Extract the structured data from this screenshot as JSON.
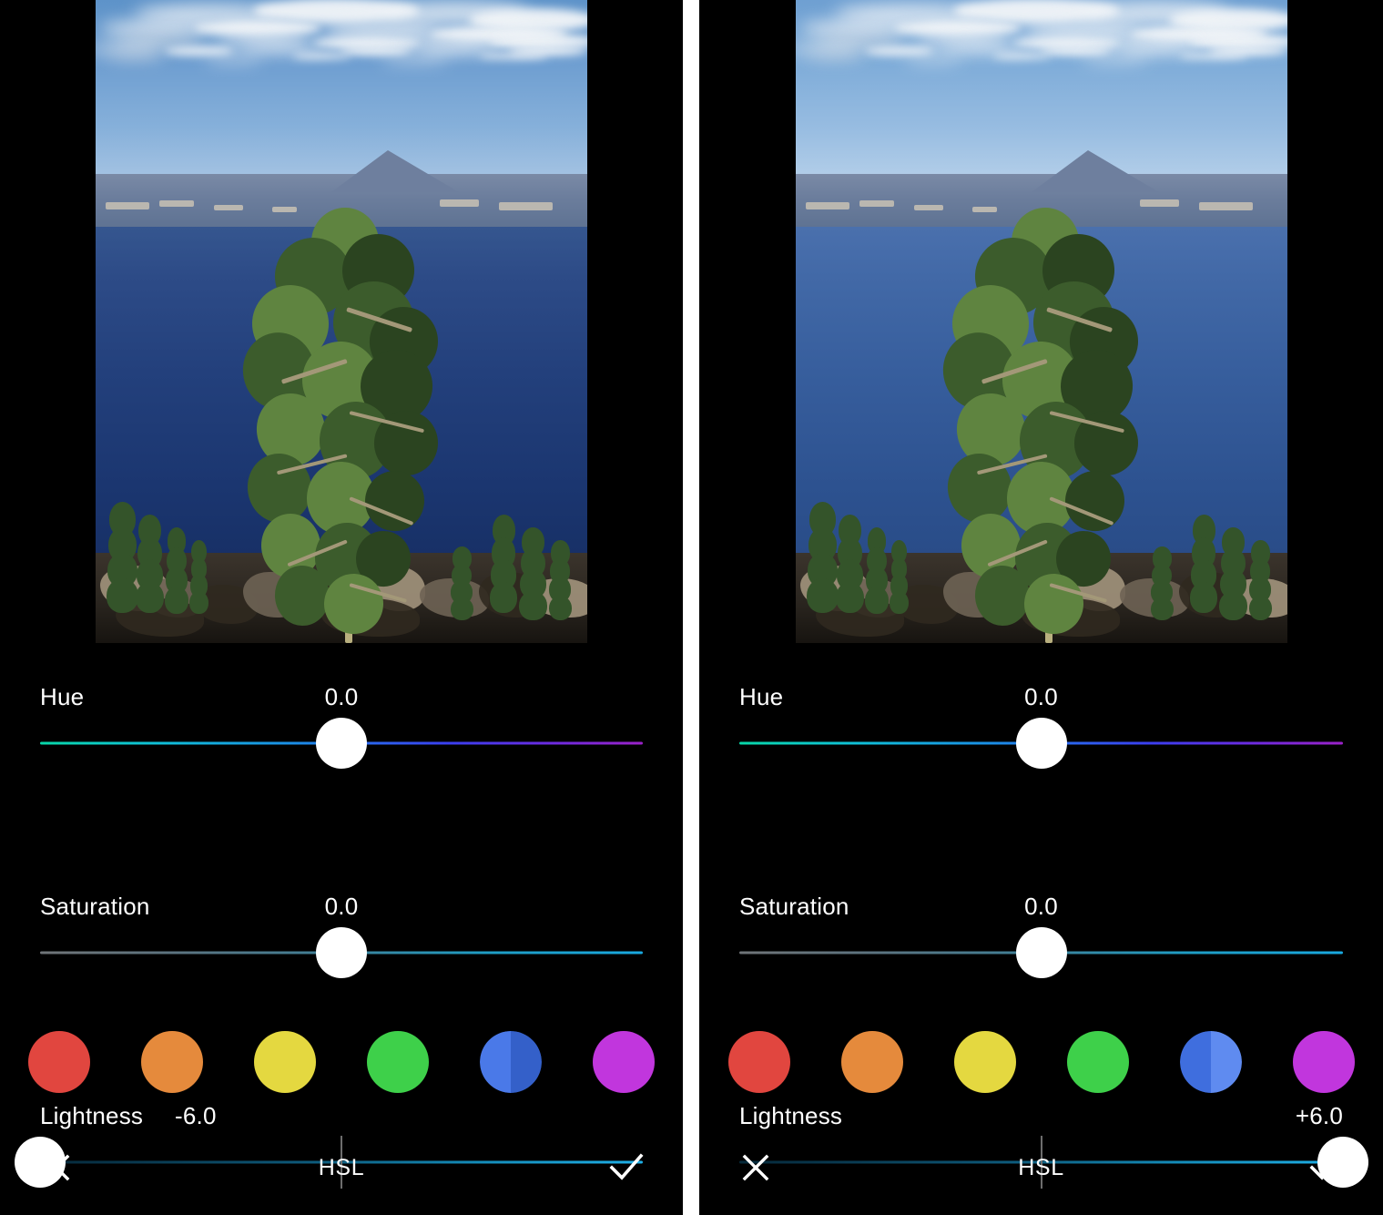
{
  "app": {
    "editor_title": "HSL",
    "background": "#000000",
    "text_color": "#ffffff"
  },
  "panels": [
    {
      "id": "before",
      "photo": {
        "alt_name": "crater-lake-photo",
        "scene": "Crater Lake with Wizard Island, pine tree in foreground",
        "variant": "normal"
      },
      "sliders": [
        {
          "name": "Hue",
          "value": "0.0",
          "knob_percent": 50,
          "value_align": "center",
          "gradient": "hue",
          "show_center_tick": false
        },
        {
          "name": "Saturation",
          "value": "0.0",
          "knob_percent": 50,
          "value_align": "center",
          "gradient": "sat",
          "show_center_tick": false
        },
        {
          "name": "Lightness",
          "value": "-6.0",
          "knob_percent": 0,
          "value_align": "inline",
          "gradient": "light",
          "show_center_tick": true
        }
      ],
      "swatches": [
        {
          "name": "red",
          "color": "#e1463f",
          "selected": false
        },
        {
          "name": "orange",
          "color": "#e58a3c",
          "selected": false
        },
        {
          "name": "yellow",
          "color": "#e4d840",
          "selected": false
        },
        {
          "name": "green",
          "color": "#3ed04a",
          "selected": false
        },
        {
          "name": "blue",
          "color": "#3f6ede",
          "color_left": "#4a79e8",
          "color_right": "#3460c9",
          "selected": true
        },
        {
          "name": "purple",
          "color": "#c136dd",
          "selected": false
        }
      ],
      "bottom_bar": {
        "cancel_icon": "close-icon",
        "title": "HSL",
        "confirm_icon": "check-icon"
      }
    },
    {
      "id": "after",
      "photo": {
        "alt_name": "crater-lake-photo",
        "scene": "Crater Lake with Wizard Island, pine tree in foreground",
        "variant": "brightened"
      },
      "sliders": [
        {
          "name": "Hue",
          "value": "0.0",
          "knob_percent": 50,
          "value_align": "center",
          "gradient": "hue",
          "show_center_tick": false
        },
        {
          "name": "Saturation",
          "value": "0.0",
          "knob_percent": 50,
          "value_align": "center",
          "gradient": "sat",
          "show_center_tick": false
        },
        {
          "name": "Lightness",
          "value": "+6.0",
          "knob_percent": 100,
          "value_align": "right",
          "gradient": "light",
          "show_center_tick": true
        }
      ],
      "swatches": [
        {
          "name": "red",
          "color": "#e1463f",
          "selected": false
        },
        {
          "name": "orange",
          "color": "#e58a3c",
          "selected": false
        },
        {
          "name": "yellow",
          "color": "#e4d840",
          "selected": false
        },
        {
          "name": "green",
          "color": "#3ed04a",
          "selected": false
        },
        {
          "name": "blue",
          "color": "#4a79e8",
          "color_left": "#3f6ede",
          "color_right": "#5f8bf0",
          "selected": true
        },
        {
          "name": "purple",
          "color": "#c136dd",
          "selected": false
        }
      ],
      "bottom_bar": {
        "cancel_icon": "close-icon",
        "title": "HSL",
        "confirm_icon": "check-icon"
      }
    }
  ]
}
